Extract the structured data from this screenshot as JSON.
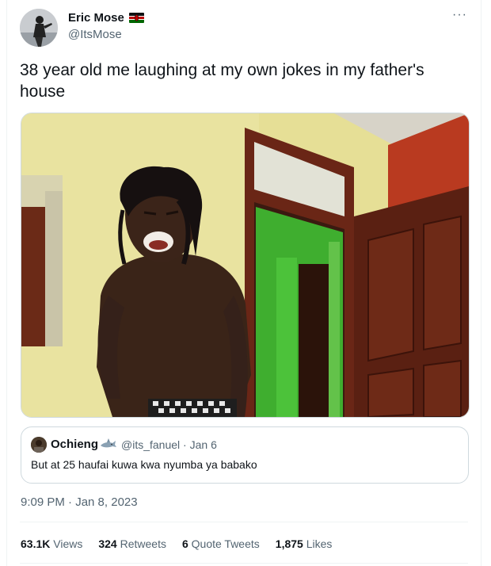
{
  "author": {
    "name": "Eric Mose",
    "handle": "@ItsMose",
    "flag_icon": "kenya-flag-icon"
  },
  "tweet": {
    "text": "38 year old me laughing at my own jokes in my father's house",
    "more_icon": "more-icon",
    "more_label": "···"
  },
  "quote": {
    "name": "Ochieng",
    "emoji_icon": "shark-emoji-icon",
    "handle": "@its_fanuel",
    "separator": "·",
    "date": "Jan 6",
    "text": "But at 25 haufai kuwa kwa nyumba ya babako"
  },
  "timestamp": "9:09 PM · Jan 8, 2023",
  "stats": {
    "views_count": "63.1K",
    "views_label": "Views",
    "retweets_count": "324",
    "retweets_label": "Retweets",
    "quotes_count": "6",
    "quotes_label": "Quote Tweets",
    "likes_count": "1,875",
    "likes_label": "Likes"
  },
  "colors": {
    "text_primary": "#0f1419",
    "text_secondary": "#536471",
    "border": "#cfd9de",
    "wall_yellow": "#e9e29a",
    "wall_red": "#b5371f",
    "door_brown": "#5c2214",
    "green_door": "#3fae2f"
  }
}
